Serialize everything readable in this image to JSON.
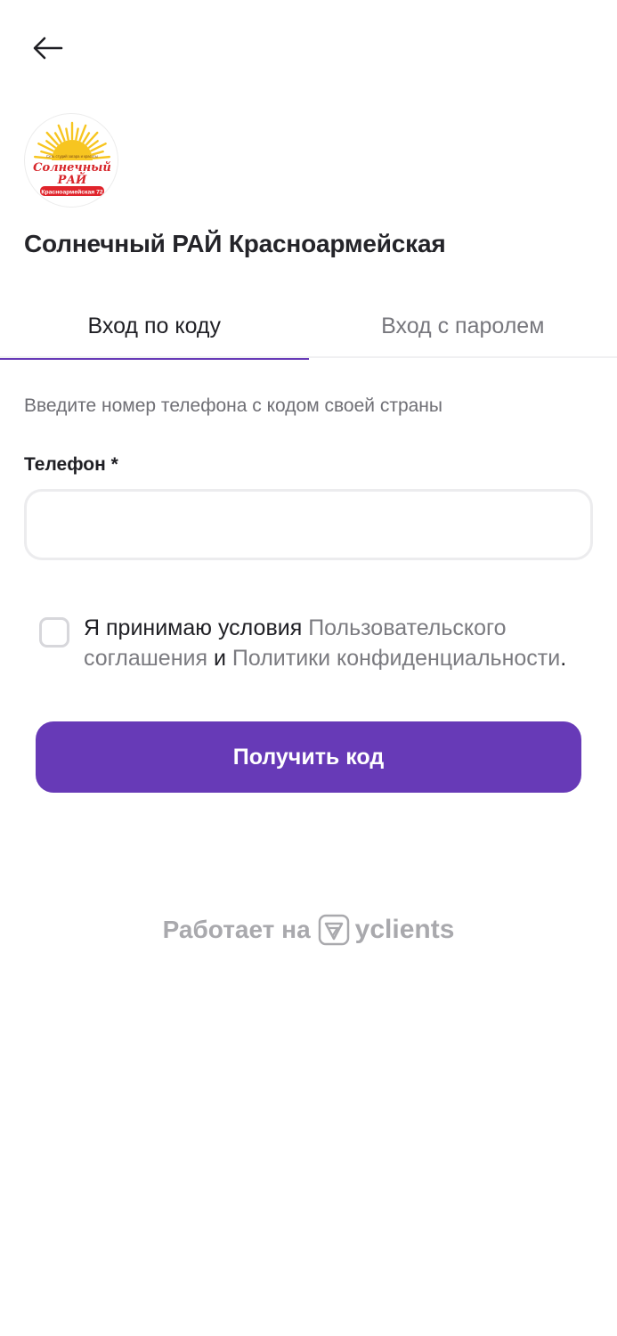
{
  "header": {
    "back_icon": "arrow-left-icon"
  },
  "logo": {
    "tagline": "Сеть студий загара и красоты",
    "name_line1": "Солнечный",
    "name_line2": "РАЙ",
    "address": "Красноармейская 72",
    "colors": {
      "sun": "#f7c520",
      "text": "#d7262b",
      "banner": "#e0242b"
    }
  },
  "org": {
    "name": "Солнечный РАЙ Красноармейская"
  },
  "tabs": [
    {
      "label": "Вход по коду",
      "active": true
    },
    {
      "label": "Вход с паролем",
      "active": false
    }
  ],
  "form": {
    "hint": "Введите номер телефона с кодом своей страны",
    "phone_label": "Телефон *",
    "phone_value": "",
    "phone_placeholder": ""
  },
  "consent": {
    "checked": false,
    "prefix": "Я принимаю условия ",
    "link1": "Пользовательского соглашения",
    "middle": " и ",
    "link2": "Политики конфиденциальности",
    "suffix": "."
  },
  "submit": {
    "label": "Получить код"
  },
  "footer": {
    "powered_by": "Работает на",
    "brand": "yclients",
    "brand_icon": "yclients-logo-icon"
  },
  "colors": {
    "accent": "#673ab7",
    "muted": "#7b7b80",
    "powered": "#a9a9ad"
  }
}
